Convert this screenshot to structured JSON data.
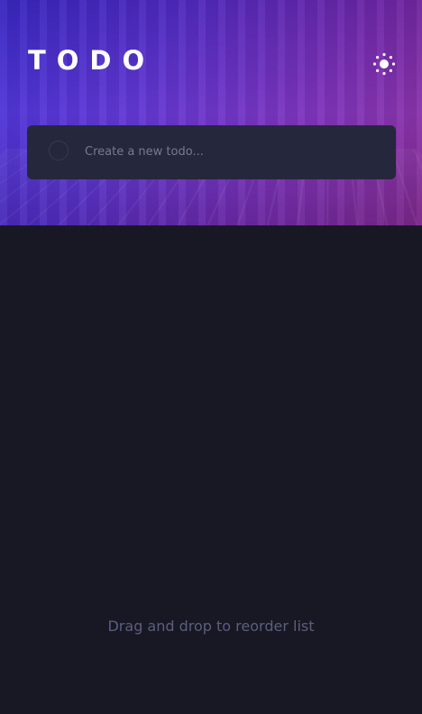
{
  "app": {
    "logo_text": "TODO"
  },
  "header": {
    "theme_toggle_icon": "sun-icon"
  },
  "new_todo": {
    "placeholder": "Create a new todo...",
    "value": ""
  },
  "footer": {
    "hint": "Drag and drop to reorder list"
  },
  "colors": {
    "background": "#181824",
    "card": "#25273c",
    "hero_gradient_start": "#3f2bd6",
    "hero_gradient_end": "#8a2a9a",
    "hint_text": "#5b5e7e"
  }
}
